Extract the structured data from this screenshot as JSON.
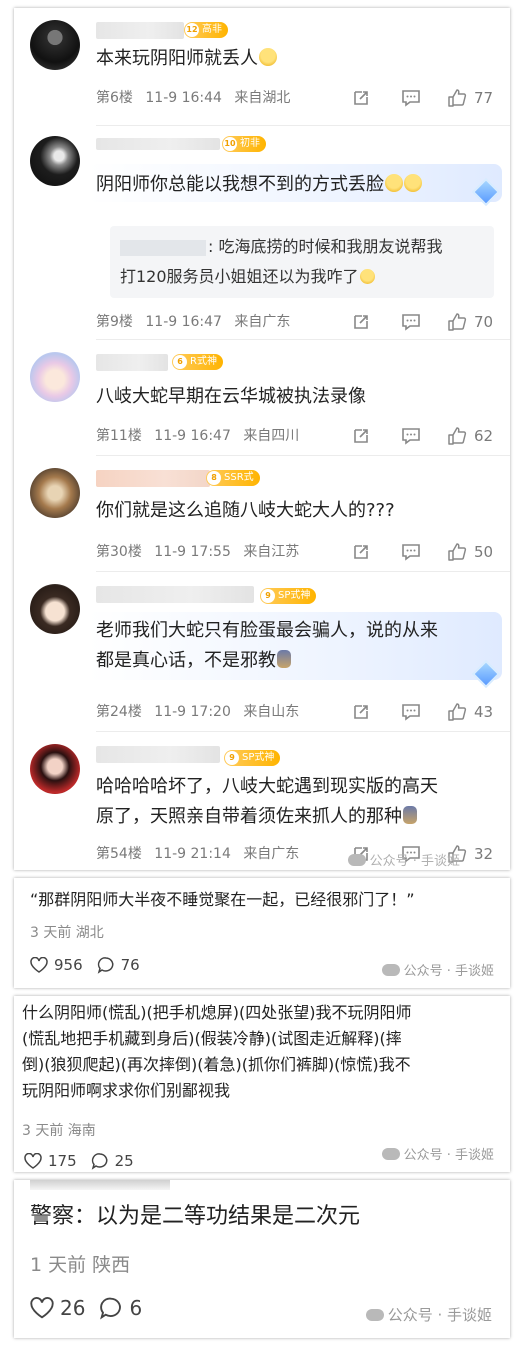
{
  "comments": [
    {
      "level": "12",
      "badge": "高非",
      "text": "本来玩阴阳师就丢人",
      "floor": "第6楼",
      "time": "11-9 16:44",
      "location": "来自湖北",
      "likes": "77"
    },
    {
      "level": "10",
      "badge": "初非",
      "text_line1": "阴阳师你总能以我想不到的方式丢脸",
      "quote_line1": ": 吃海底捞的时候和我朋友说帮我",
      "quote_line2": "打120服务员小姐姐还以为我咋了",
      "floor": "第9楼",
      "time": "11-9 16:47",
      "location": "来自广东",
      "likes": "70"
    },
    {
      "level": "6",
      "badge": "R式神",
      "text": "八岐大蛇早期在云华城被执法录像",
      "floor": "第11楼",
      "time": "11-9 16:47",
      "location": "来自四川",
      "likes": "62"
    },
    {
      "level": "8",
      "badge": "SSR式",
      "text": "你们就是这么追随八岐大蛇大人的???",
      "floor": "第30楼",
      "time": "11-9 17:55",
      "location": "来自江苏",
      "likes": "50"
    },
    {
      "level": "9",
      "badge": "SP式神",
      "text_line1": "老师我们大蛇只有脸蛋最会骗人，说的从来",
      "text_line2": "都是真心话，不是邪教",
      "floor": "第24楼",
      "time": "11-9 17:20",
      "location": "来自山东",
      "likes": "43"
    },
    {
      "level": "9",
      "badge": "SP式神",
      "text_line1": "哈哈哈哈坏了，八岐大蛇遇到现实版的高天",
      "text_line2": "原了，天照亲自带着须佐来抓人的那种",
      "floor": "第54楼",
      "time": "11-9 21:14",
      "location": "来自广东",
      "likes": "32"
    }
  ],
  "watermark": "公众号 · 手谈姬",
  "cards": [
    {
      "text": "“那群阴阳师大半夜不睡觉聚在一起，已经很邪门了！”",
      "meta": "3 天前  湖北",
      "likes": "956",
      "replies": "76"
    },
    {
      "text_line1": "什么阴阳师(慌乱)(把手机熄屏)(四处张望)我不玩阴阳师",
      "text_line2": "(慌乱地把手机藏到身后)(假装冷静)(试图走近解释)(摔",
      "text_line3": "倒)(狼狈爬起)(再次摔倒)(着急)(抓你们裤脚)(惊慌)我不",
      "text_line4": "玩阴阳师啊求求你们别鄙视我",
      "meta": "3 天前  海南",
      "likes": "175",
      "replies": "25"
    },
    {
      "text": "警察：以为是二等功结果是二次元",
      "meta": "1 天前  陕西",
      "likes": "26",
      "replies": "6"
    }
  ]
}
